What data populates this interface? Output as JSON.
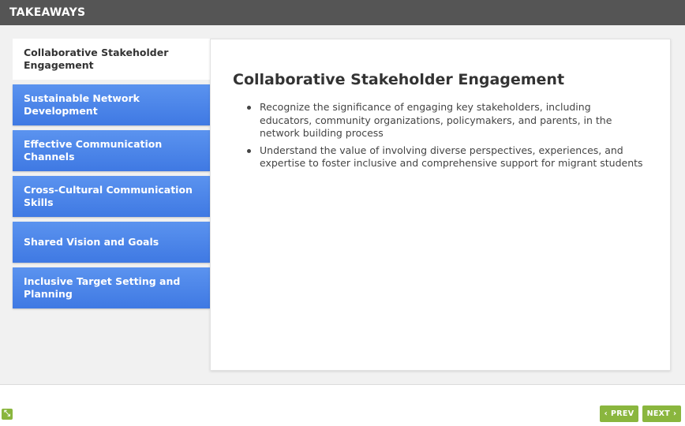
{
  "header": {
    "title": "TAKEAWAYS"
  },
  "tabs": [
    {
      "label": "Collaborative Stakeholder Engagement",
      "active": true
    },
    {
      "label": "Sustainable Network Development",
      "active": false
    },
    {
      "label": "Effective Communication Channels",
      "active": false
    },
    {
      "label": "Cross-Cultural Communication Skills",
      "active": false
    },
    {
      "label": "Shared Vision and Goals",
      "active": false
    },
    {
      "label": "Inclusive Target Setting and Planning",
      "active": false
    }
  ],
  "panel": {
    "title": "Collaborative Stakeholder Engagement",
    "bullets": [
      "Recognize the significance of engaging key stakeholders, including educators, community organizations, policymakers, and parents, in the network building process",
      "Understand the value of involving diverse perspectives, experiences, and expertise to foster inclusive and comprehensive support for migrant students"
    ]
  },
  "nav": {
    "prev_label": "PREV",
    "next_label": "NEXT"
  },
  "colors": {
    "header_bg": "#555555",
    "tab_blue": "#4a84e8",
    "nav_green": "#8ab63e"
  },
  "icons": {
    "corner": "collapse-arrows-icon",
    "prev": "chevron-left-icon",
    "next": "chevron-right-icon"
  }
}
